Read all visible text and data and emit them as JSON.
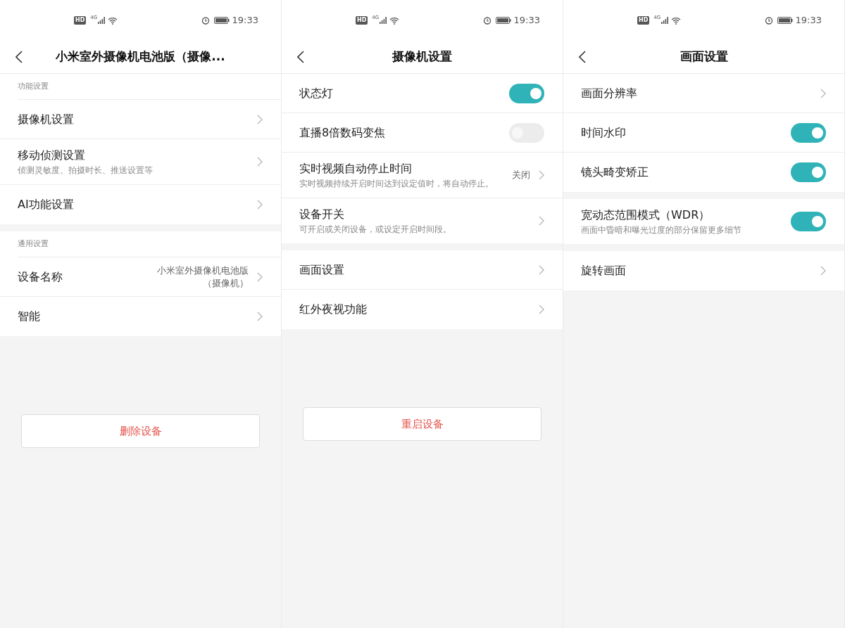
{
  "screens": [
    {
      "status_bar": {
        "hd": "HD",
        "network": "4G",
        "time": "19:33"
      },
      "title": "小米室外摄像机电池版（摄像...",
      "groups": [
        {
          "header": "功能设置",
          "items": [
            {
              "kind": "link",
              "label": "摄像机设置"
            },
            {
              "kind": "link",
              "label": "移动侦测设置",
              "subtitle": "侦测灵敏度、拍摄时长、推送设置等"
            },
            {
              "kind": "link",
              "label": "AI功能设置"
            }
          ]
        },
        {
          "header": "通用设置",
          "items": [
            {
              "kind": "link",
              "label": "设备名称",
              "value": "小米室外摄像机电池版（摄像机）"
            },
            {
              "kind": "link",
              "label": "智能"
            }
          ]
        }
      ],
      "button": "删除设备"
    },
    {
      "status_bar": {
        "hd": "HD",
        "network": "4G",
        "time": "19:33"
      },
      "title": "摄像机设置",
      "groups": [
        {
          "items": [
            {
              "kind": "toggle",
              "label": "状态灯",
              "on": true
            },
            {
              "kind": "toggle",
              "label": "直播8倍数码变焦",
              "on": false
            },
            {
              "kind": "link",
              "label": "实时视频自动停止时间",
              "subtitle": "实时视频持续开启时间达到设定值时，将自动停止。",
              "value": "关闭"
            },
            {
              "kind": "link",
              "label": "设备开关",
              "subtitle": "可开启或关闭设备，或设定开启时间段。"
            }
          ]
        },
        {
          "items": [
            {
              "kind": "link",
              "label": "画面设置"
            },
            {
              "kind": "link",
              "label": "红外夜视功能"
            }
          ]
        }
      ],
      "button": "重启设备"
    },
    {
      "status_bar": {
        "hd": "HD",
        "network": "4G",
        "time": "19:33"
      },
      "title": "画面设置",
      "groups": [
        {
          "items": [
            {
              "kind": "link",
              "label": "画面分辨率"
            },
            {
              "kind": "toggle",
              "label": "时间水印",
              "on": true
            },
            {
              "kind": "toggle",
              "label": "镜头畸变矫正",
              "on": true
            }
          ]
        },
        {
          "items": [
            {
              "kind": "toggle",
              "label": "宽动态范围模式（WDR）",
              "subtitle": "画面中昏暗和曝光过度的部分保留更多细节",
              "on": true
            }
          ]
        },
        {
          "items": [
            {
              "kind": "link",
              "label": "旋转画面"
            }
          ]
        }
      ]
    }
  ]
}
